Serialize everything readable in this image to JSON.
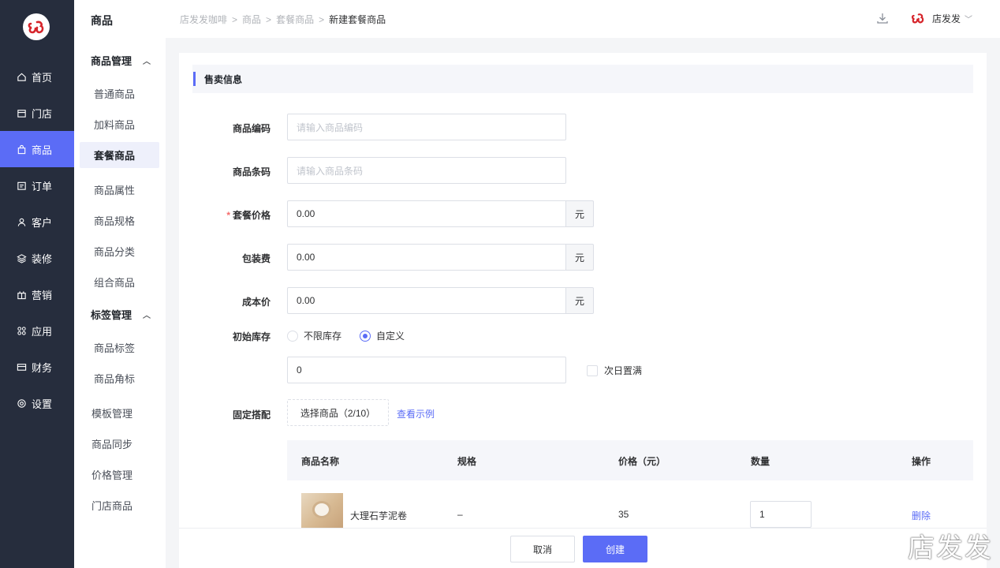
{
  "nav": {
    "items": [
      {
        "label": "首页",
        "icon": "home-icon"
      },
      {
        "label": "门店",
        "icon": "store-icon"
      },
      {
        "label": "商品",
        "icon": "bag-icon"
      },
      {
        "label": "订单",
        "icon": "order-icon"
      },
      {
        "label": "客户",
        "icon": "user-icon"
      },
      {
        "label": "装修",
        "icon": "layers-icon"
      },
      {
        "label": "营销",
        "icon": "gift-icon"
      },
      {
        "label": "应用",
        "icon": "apps-icon"
      },
      {
        "label": "财务",
        "icon": "card-icon"
      },
      {
        "label": "设置",
        "icon": "settings-icon"
      }
    ],
    "active": "商品",
    "accent": "#5b6cf6"
  },
  "subnav": {
    "title": "商品",
    "group1": "商品管理",
    "group1_items": [
      "普通商品",
      "加料商品",
      "套餐商品",
      "商品属性",
      "商品规格",
      "商品分类",
      "组合商品"
    ],
    "group2": "标签管理",
    "group2_items": [
      "商品标签",
      "商品角标"
    ],
    "other_items": [
      "模板管理",
      "商品同步",
      "价格管理",
      "门店商品"
    ],
    "active": "套餐商品"
  },
  "breadcrumb": [
    "店发发咖啡",
    "商品",
    "套餐商品",
    "新建套餐商品"
  ],
  "user": {
    "name": "店发发"
  },
  "form": {
    "section_title": "售卖信息",
    "code_label": "商品编码",
    "code_placeholder": "请输入商品编码",
    "barcode_label": "商品条码",
    "barcode_placeholder": "请输入商品条码",
    "price_label": "套餐价格",
    "price_value": "0.00",
    "packing_label": "包装费",
    "packing_value": "0.00",
    "cost_label": "成本价",
    "cost_value": "0.00",
    "currency": "元",
    "stock_label": "初始库存",
    "stock_option_unlimited": "不限库存",
    "stock_option_custom": "自定义",
    "stock_value": "0",
    "refill_label": "次日置满",
    "combo_label": "固定搭配",
    "select_button": "选择商品（2/10）",
    "example_link": "查看示例"
  },
  "table": {
    "headers": [
      "商品名称",
      "规格",
      "价格（元）",
      "数量",
      "操作"
    ],
    "rows": [
      {
        "name": "大理石芋泥卷",
        "spec": "–",
        "price": "35",
        "qty": "1",
        "action": "删除"
      }
    ]
  },
  "footer": {
    "cancel": "取消",
    "create": "创建"
  },
  "watermark": "店发发"
}
